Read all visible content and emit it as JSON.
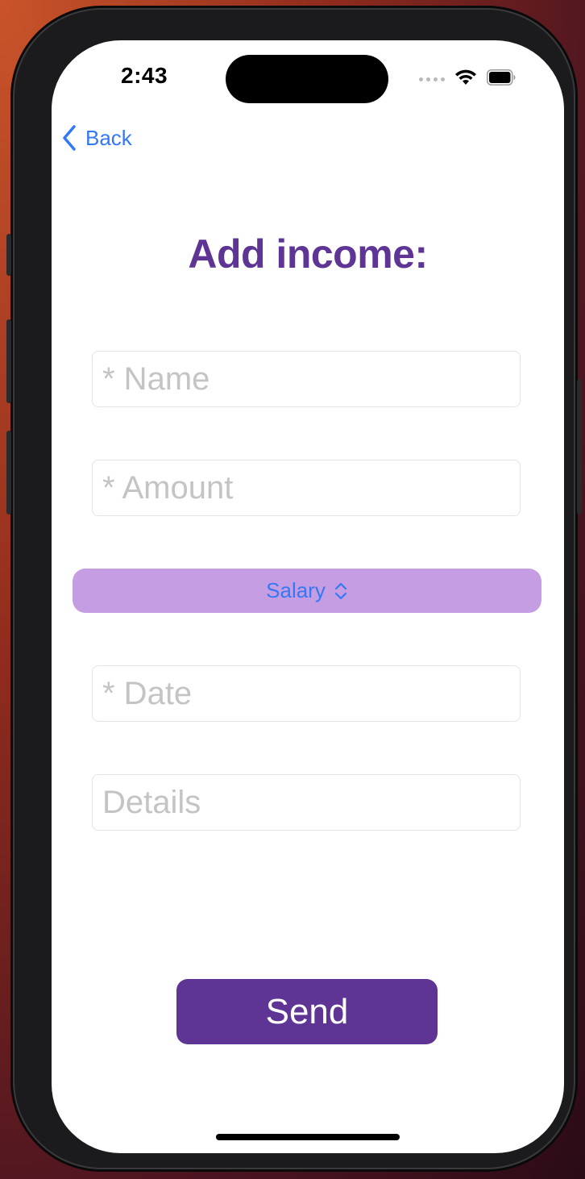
{
  "status_bar": {
    "time": "2:43",
    "signal_icon": "cellular-dots-icon",
    "wifi_icon": "wifi-icon",
    "battery_icon": "battery-full-icon"
  },
  "nav": {
    "back_label": "Back",
    "back_icon": "chevron-left-icon"
  },
  "page": {
    "title": "Add income:"
  },
  "form": {
    "name_placeholder": "* Name",
    "amount_placeholder": "* Amount",
    "category_selected": "Salary",
    "category_icon": "chevron-up-down-icon",
    "date_placeholder": "* Date",
    "details_placeholder": "Details",
    "send_label": "Send"
  },
  "colors": {
    "accent_purple": "#5e3594",
    "picker_background": "#c59de3",
    "link_blue": "#3478f6",
    "placeholder_gray": "#c4c4c6"
  }
}
